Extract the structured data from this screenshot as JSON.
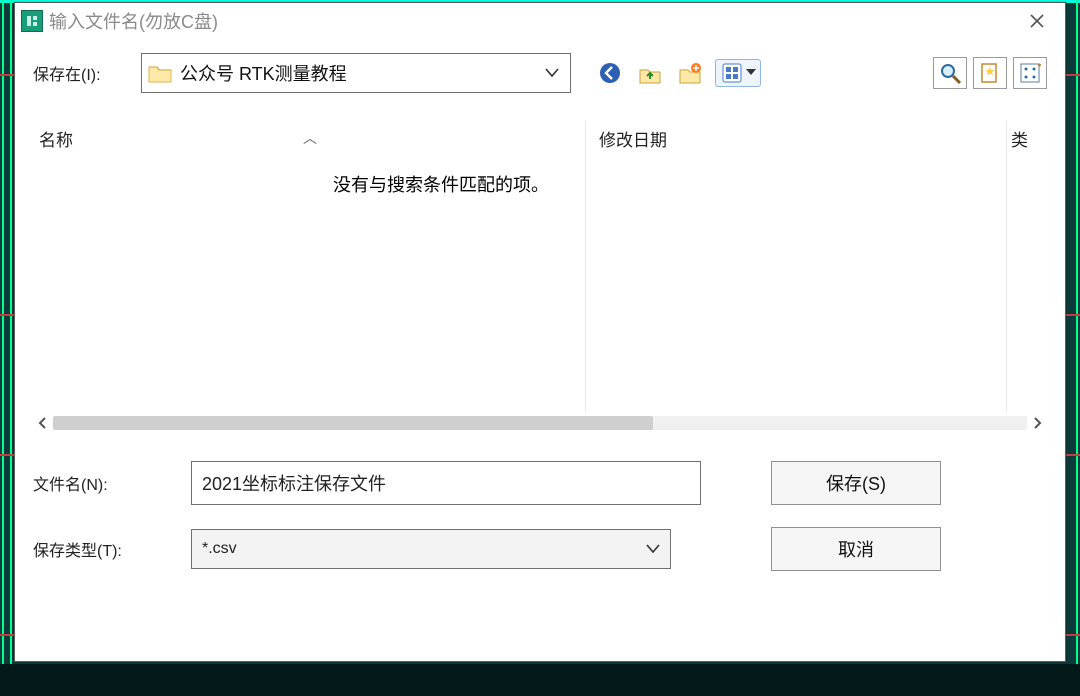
{
  "window": {
    "title": "输入文件名(勿放C盘)"
  },
  "toolbar": {
    "save_in_label": "保存在(I):",
    "current_folder": "公众号 RTK测量教程"
  },
  "columns": {
    "name": "名称",
    "modified": "修改日期",
    "type_clipped": "类"
  },
  "list": {
    "empty_message": "没有与搜索条件匹配的项。"
  },
  "form": {
    "filename_label": "文件名(N):",
    "filename_value": "2021坐标标注保存文件",
    "filetype_label": "保存类型(T):",
    "filetype_value": "*.csv"
  },
  "buttons": {
    "save": "保存(S)",
    "cancel": "取消"
  }
}
